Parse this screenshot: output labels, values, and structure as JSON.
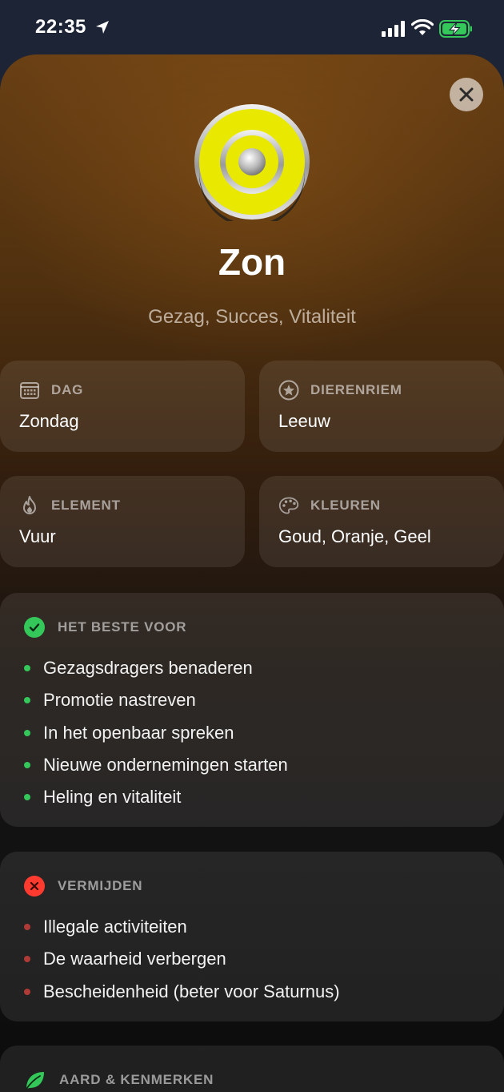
{
  "status_bar": {
    "time": "22:35"
  },
  "planet": {
    "title": "Zon",
    "subtitle": "Gezag, Succes, Vitaliteit",
    "icon": "sun-icon",
    "color": "#e8e800"
  },
  "info_cards": {
    "day": {
      "label": "DAG",
      "value": "Zondag",
      "icon": "calendar-icon"
    },
    "zodiac": {
      "label": "DIERENRIEM",
      "value": "Leeuw",
      "icon": "star-circle-icon"
    },
    "element": {
      "label": "ELEMENT",
      "value": "Vuur",
      "icon": "flame-icon"
    },
    "colors": {
      "label": "KLEUREN",
      "value": "Goud, Oranje, Geel",
      "icon": "palette-icon"
    }
  },
  "best_for": {
    "label": "HET BESTE VOOR",
    "icon": "check-circle-icon",
    "color": "#34c759",
    "items": [
      "Gezagsdragers benaderen",
      "Promotie nastreven",
      "In het openbaar spreken",
      "Nieuwe ondernemingen starten",
      "Heling en vitaliteit"
    ]
  },
  "avoid": {
    "label": "VERMIJDEN",
    "icon": "x-circle-icon",
    "color": "#ff3b30",
    "items": [
      "Illegale activiteiten",
      "De waarheid verbergen",
      "Bescheidenheid (beter voor Saturnus)"
    ]
  },
  "nature": {
    "label": "AARD & KENMERKEN",
    "icon": "leaf-icon",
    "color": "#34c759"
  }
}
